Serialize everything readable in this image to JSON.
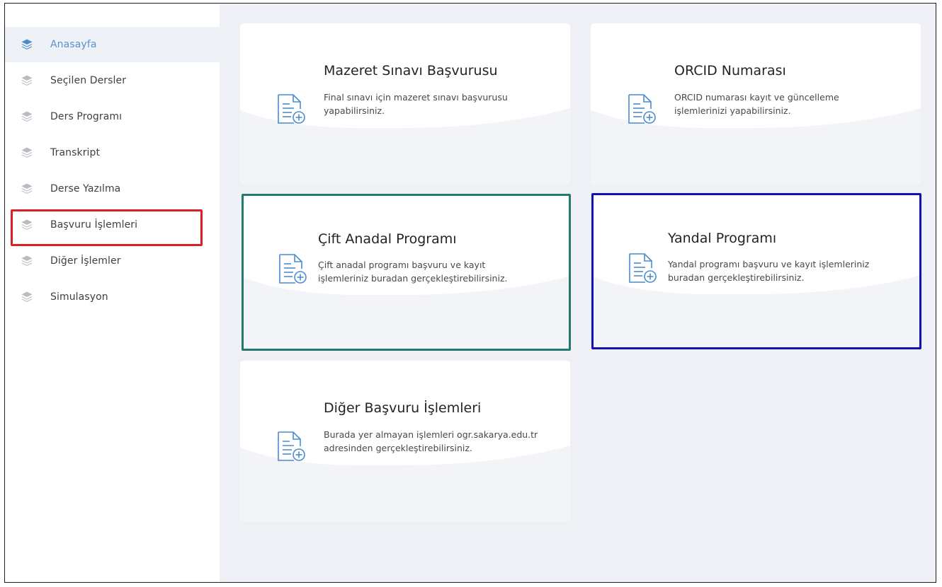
{
  "sidebar": {
    "items": [
      {
        "label": "Anasayfa",
        "icon": "layers-icon",
        "active": true
      },
      {
        "label": "Seçilen Dersler",
        "icon": "layers-icon"
      },
      {
        "label": "Ders Programı",
        "icon": "layers-icon"
      },
      {
        "label": "Transkript",
        "icon": "layers-icon"
      },
      {
        "label": "Derse Yazılma",
        "icon": "layers-icon"
      },
      {
        "label": "Başvuru İşlemleri",
        "icon": "layers-icon"
      },
      {
        "label": "Diğer İşlemler",
        "icon": "layers-icon"
      },
      {
        "label": "Simulasyon",
        "icon": "layers-icon"
      }
    ]
  },
  "cards": [
    {
      "title": "Mazeret Sınavı Başvurusu",
      "desc": "Final sınavı için mazeret sınavı başvurusu yapabilirsiniz.",
      "icon": "document-add-icon"
    },
    {
      "title": "ORCID Numarası",
      "desc": "ORCID numarası kayıt ve güncelleme işlemlerinizi yapabilirsiniz.",
      "icon": "document-add-icon"
    },
    {
      "title": "Çift Anadal Programı",
      "desc": "Çift anadal programı başvuru ve kayıt işlemleriniz buradan gerçekleştirebilirsiniz.",
      "icon": "document-add-icon"
    },
    {
      "title": "Yandal Programı",
      "desc": "Yandal programı başvuru ve kayıt işlemleriniz buradan gerçekleştirebilirsiniz.",
      "icon": "document-add-icon"
    },
    {
      "title": "Diğer Başvuru İşlemleri",
      "desc": "Burada yer almayan işlemleri ogr.sakarya.edu.tr adresinden gerçekleştirebilirsiniz.",
      "icon": "document-add-icon"
    }
  ],
  "colors": {
    "accent": "#5a92cf",
    "icon_inactive": "#b9bcc3",
    "highlight_red": "#db1f26",
    "highlight_green": "#23796f",
    "highlight_blue": "#1010b5",
    "content_background": "#eef0f6"
  }
}
